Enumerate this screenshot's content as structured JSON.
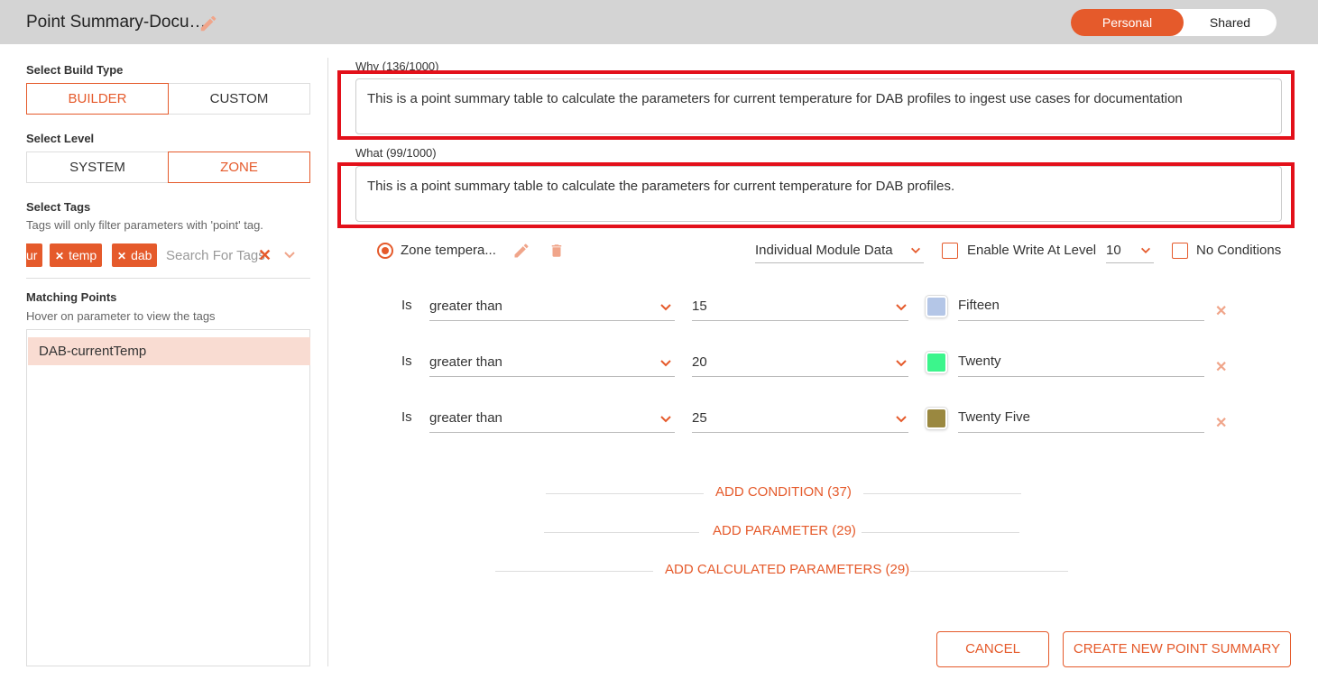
{
  "header": {
    "title": "Point Summary-Docu…",
    "toggle": {
      "personal": "Personal",
      "shared": "Shared"
    }
  },
  "sidebar": {
    "build_type_label": "Select Build Type",
    "build_types": [
      "BUILDER",
      "CUSTOM"
    ],
    "level_label": "Select Level",
    "levels": [
      "SYSTEM",
      "ZONE"
    ],
    "tags_label": "Select Tags",
    "tags_hint": "Tags will only filter parameters with 'point' tag.",
    "tags": [
      "ur",
      "temp",
      "dab"
    ],
    "tag_search_placeholder": "Search For Tags",
    "matching_label": "Matching Points",
    "matching_hint": "Hover on parameter to view the tags",
    "matching_points": [
      "DAB-currentTemp"
    ]
  },
  "why": {
    "label": "Why (136/1000)",
    "value": "This is a point summary table to calculate the parameters for current temperature for DAB profiles to ingest use cases for documentation"
  },
  "what": {
    "label": "What (99/1000)",
    "value": "This is a point summary table to calculate the parameters for current temperature for DAB profiles."
  },
  "parameter": {
    "name": "Zone tempera...",
    "data_mode": "Individual Module Data",
    "enable_write_label": "Enable Write At Level",
    "write_level": "10",
    "no_conditions_label": "No Conditions"
  },
  "conditions": [
    {
      "is": "Is",
      "operator": "greater than",
      "value": "15",
      "color": "#b4c6e7",
      "name": "Fifteen"
    },
    {
      "is": "Is",
      "operator": "greater than",
      "value": "20",
      "color": "#3cf58c",
      "name": "Twenty"
    },
    {
      "is": "Is",
      "operator": "greater than",
      "value": "25",
      "color": "#9a8840",
      "name": "Twenty Five"
    }
  ],
  "actions": {
    "add_condition": "ADD CONDITION (37)",
    "add_parameter": "ADD PARAMETER (29)",
    "add_calculated": "ADD CALCULATED PARAMETERS (29)",
    "cancel": "CANCEL",
    "create": "CREATE NEW POINT SUMMARY"
  },
  "colors": {
    "accent": "#e55a2b",
    "highlight": "#e3101a"
  }
}
